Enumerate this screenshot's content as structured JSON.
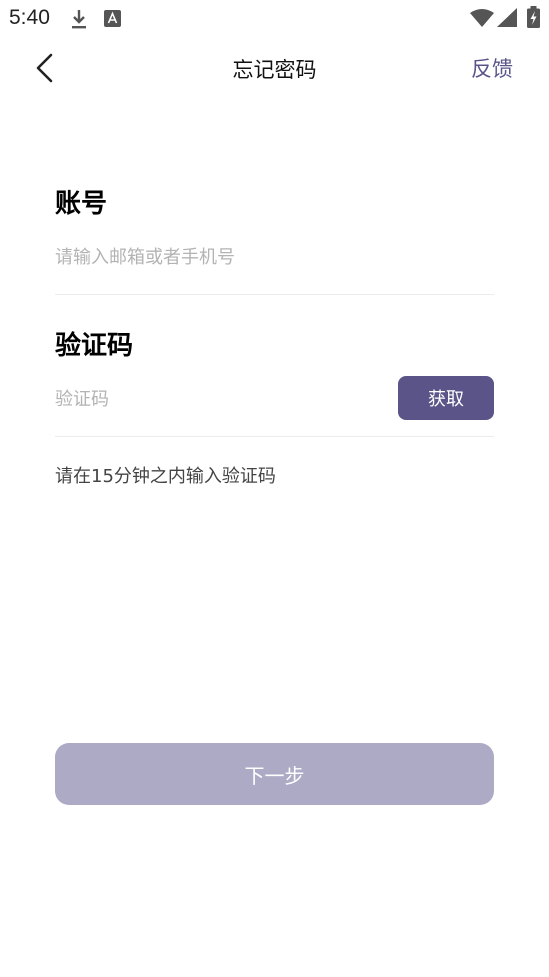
{
  "status_bar": {
    "time": "5:40"
  },
  "nav": {
    "title": "忘记密码",
    "feedback_label": "反馈"
  },
  "form": {
    "account_label": "账号",
    "account_placeholder": "请输入邮箱或者手机号",
    "code_label": "验证码",
    "code_placeholder": "验证码",
    "get_code_label": "获取",
    "hint": "请在15分钟之内输入验证码",
    "next_label": "下一步"
  },
  "colors": {
    "accent": "#5a5489",
    "next_disabled": "#acaac5",
    "placeholder": "#b3b3b3"
  },
  "icons": {
    "status": [
      "download-icon",
      "app-notification-icon",
      "wifi-icon",
      "signal-icon",
      "battery-charging-icon"
    ],
    "nav": [
      "back-arrow-icon"
    ]
  }
}
